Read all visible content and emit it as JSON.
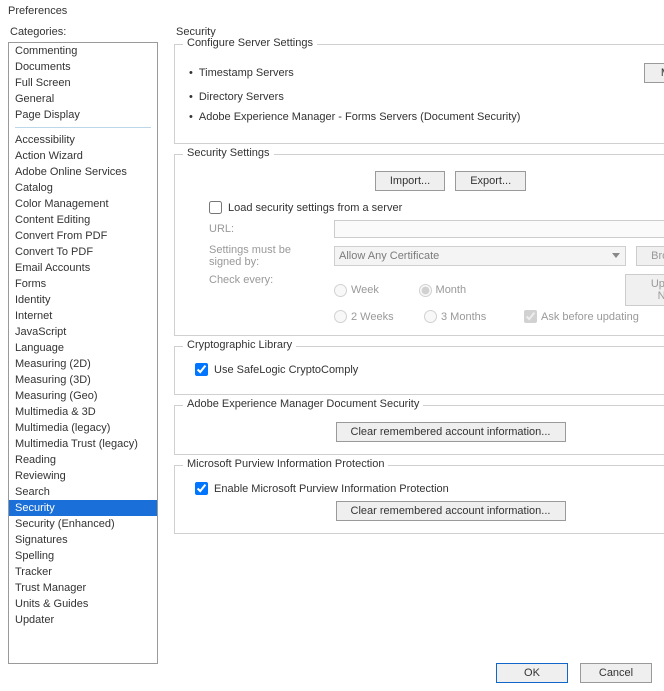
{
  "window": {
    "title": "Preferences"
  },
  "sidebar": {
    "label": "Categories:",
    "group1": [
      "Commenting",
      "Documents",
      "Full Screen",
      "General",
      "Page Display"
    ],
    "group2": [
      "Accessibility",
      "Action Wizard",
      "Adobe Online Services",
      "Catalog",
      "Color Management",
      "Content Editing",
      "Convert From PDF",
      "Convert To PDF",
      "Email Accounts",
      "Forms",
      "Identity",
      "Internet",
      "JavaScript",
      "Language",
      "Measuring (2D)",
      "Measuring (3D)",
      "Measuring (Geo)",
      "Multimedia & 3D",
      "Multimedia (legacy)",
      "Multimedia Trust (legacy)",
      "Reading",
      "Reviewing",
      "Search",
      "Security",
      "Security (Enhanced)",
      "Signatures",
      "Spelling",
      "Tracker",
      "Trust Manager",
      "Units & Guides",
      "Updater"
    ],
    "selected": "Security"
  },
  "page": {
    "title": "Security"
  },
  "serverSettings": {
    "title": "Configure Server Settings",
    "items": [
      "Timestamp Servers",
      "Directory Servers",
      "Adobe Experience Manager - Forms Servers (Document Security)"
    ],
    "more": "More..."
  },
  "securitySettings": {
    "title": "Security Settings",
    "import": "Import...",
    "export": "Export...",
    "loadFromServer": "Load security settings from a server",
    "urlLabel": "URL:",
    "urlValue": "",
    "signedByLabel": "Settings must be signed by:",
    "signedByValue": "Allow Any Certificate",
    "browse": "Browse...",
    "checkEveryLabel": "Check every:",
    "radios": {
      "week": "Week",
      "month": "Month",
      "twoWeeks": "2 Weeks",
      "threeMonths": "3 Months"
    },
    "askBefore": "Ask before updating",
    "updateNow": "Update Now"
  },
  "crypto": {
    "title": "Cryptographic Library",
    "label": "Use SafeLogic CryptoComply"
  },
  "aem": {
    "title": "Adobe Experience Manager Document Security",
    "clear": "Clear remembered account information..."
  },
  "mpip": {
    "title": "Microsoft Purview Information Protection",
    "enable": "Enable Microsoft Purview Information Protection",
    "clear": "Clear remembered account information..."
  },
  "footer": {
    "ok": "OK",
    "cancel": "Cancel"
  }
}
